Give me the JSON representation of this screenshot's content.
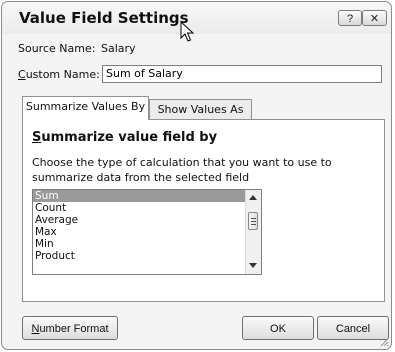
{
  "window": {
    "title": "Value Field Settings",
    "help_label": "?",
    "close_label": "✕"
  },
  "source": {
    "label": "Source Name:",
    "value": "Salary"
  },
  "custom_name": {
    "label_first": "C",
    "label_rest": "ustom Name:",
    "value": "Sum of Salary"
  },
  "tabs": [
    {
      "label": "Summarize Values By",
      "active": true
    },
    {
      "label": "Show Values As",
      "active": false
    }
  ],
  "summarize": {
    "heading_first": "S",
    "heading_rest": "ummarize value field by",
    "description": "Choose the type of calculation that you want to use to summarize data from the selected field",
    "items": [
      "Sum",
      "Count",
      "Average",
      "Max",
      "Min",
      "Product"
    ],
    "selected": "Sum"
  },
  "buttons": {
    "number_format_first": "N",
    "number_format_rest": "umber Format",
    "ok": "OK",
    "cancel": "Cancel"
  }
}
